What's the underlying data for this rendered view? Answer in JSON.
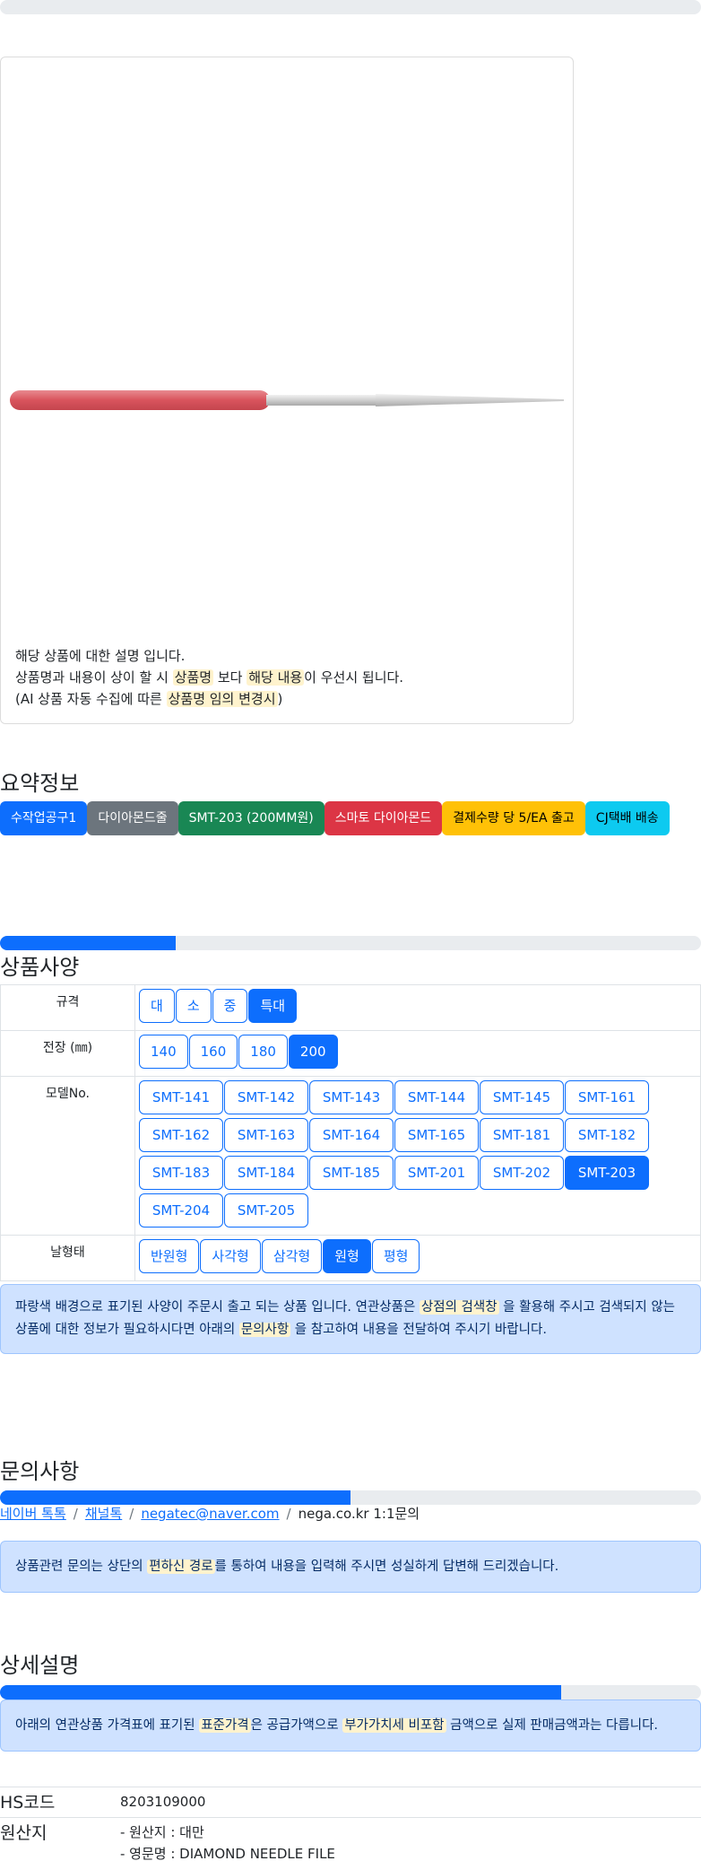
{
  "product": {
    "description_lines": [
      "해당 상품에 대한 설명 입니다."
    ],
    "line2": {
      "prefix": "상품명과 내용이 상이 할 시 ",
      "hl1": "상품명",
      "mid": " 보다 ",
      "hl2": "해당 내용",
      "suffix": "이 우선시 됩니다."
    },
    "line3": {
      "prefix": "(AI 상품 자동 수집에 따른 ",
      "hl": "상품명 임의 변경시",
      "suffix": ")"
    }
  },
  "summary": {
    "title": "요약정보",
    "badges": [
      {
        "label": "수작업공구1",
        "bg": "#0d6efd",
        "fg": "#ffffff"
      },
      {
        "label": "다이아몬드줄",
        "bg": "#6c757d",
        "fg": "#ffffff"
      },
      {
        "label": "SMT-203 (200MM원)",
        "bg": "#198754",
        "fg": "#ffffff"
      },
      {
        "label": "스마토 다이아몬드",
        "bg": "#dc3545",
        "fg": "#ffffff"
      },
      {
        "label": "결제수량 당 5/EA 출고",
        "bg": "#ffc107",
        "fg": "#000000"
      },
      {
        "label": "CJ택배 배송",
        "bg": "#0dcaf0",
        "fg": "#000000"
      }
    ]
  },
  "spec": {
    "title": "상품사양",
    "progress": 0.25,
    "rows": [
      {
        "label": "규격",
        "options": [
          "대",
          "소",
          "중",
          "특대"
        ],
        "selected": "특대"
      },
      {
        "label": "전장 (㎜)",
        "options": [
          "140",
          "160",
          "180",
          "200"
        ],
        "selected": "200"
      },
      {
        "label": "모델No.",
        "options": [
          "SMT-141",
          "SMT-142",
          "SMT-143",
          "SMT-144",
          "SMT-145",
          "SMT-161",
          "SMT-162",
          "SMT-163",
          "SMT-164",
          "SMT-165",
          "SMT-181",
          "SMT-182",
          "SMT-183",
          "SMT-184",
          "SMT-185",
          "SMT-201",
          "SMT-202",
          "SMT-203",
          "SMT-204",
          "SMT-205"
        ],
        "selected": "SMT-203"
      },
      {
        "label": "날형태",
        "options": [
          "반원형",
          "사각형",
          "삼각형",
          "원형",
          "평형"
        ],
        "selected": "원형"
      }
    ],
    "notice": {
      "p1": "파랑색 배경으로 표기된 사양이 주문시 출고 되는 상품 입니다. 연관상품은 ",
      "hl1": "상점의 검색창",
      "p2": " 을 활용해 주시고 검색되지 않는 상품에 대한 정보가 필요하시다면 아래의 ",
      "hl2": "문의사항",
      "p3": " 을 참고하여 내용을 전달하여 주시기 바랍니다."
    }
  },
  "inquiry": {
    "title": "문의사항",
    "progress": 0.5,
    "links": [
      "네이버 톡톡",
      "채널톡",
      "negatec@naver.com"
    ],
    "plain": "nega.co.kr 1:1문의",
    "separator": "/",
    "notice": {
      "p1": "상품관련 문의는 상단의 ",
      "hl": "편하신 경로",
      "p2": "를 통하여 내용을 입력해 주시면 성실하게 답변해 드리겠습니다."
    }
  },
  "detail": {
    "title": "상세설명",
    "progress": 0.8,
    "notice": {
      "p1": "아래의 연관상품 가격표에 표기된 ",
      "hl1": "표준가격",
      "p2": "은 공급가액으로 ",
      "hl2": "부가가치세 비포함",
      "p3": " 금액으로 실제 판매금액과는 다릅니다."
    },
    "hs": {
      "key": "HS코드",
      "value": "8203109000"
    },
    "origin": {
      "key": "원산지",
      "lines": [
        "- 원산지 : 대만",
        "- 영문명 : DIAMOND NEEDLE FILE"
      ]
    }
  }
}
